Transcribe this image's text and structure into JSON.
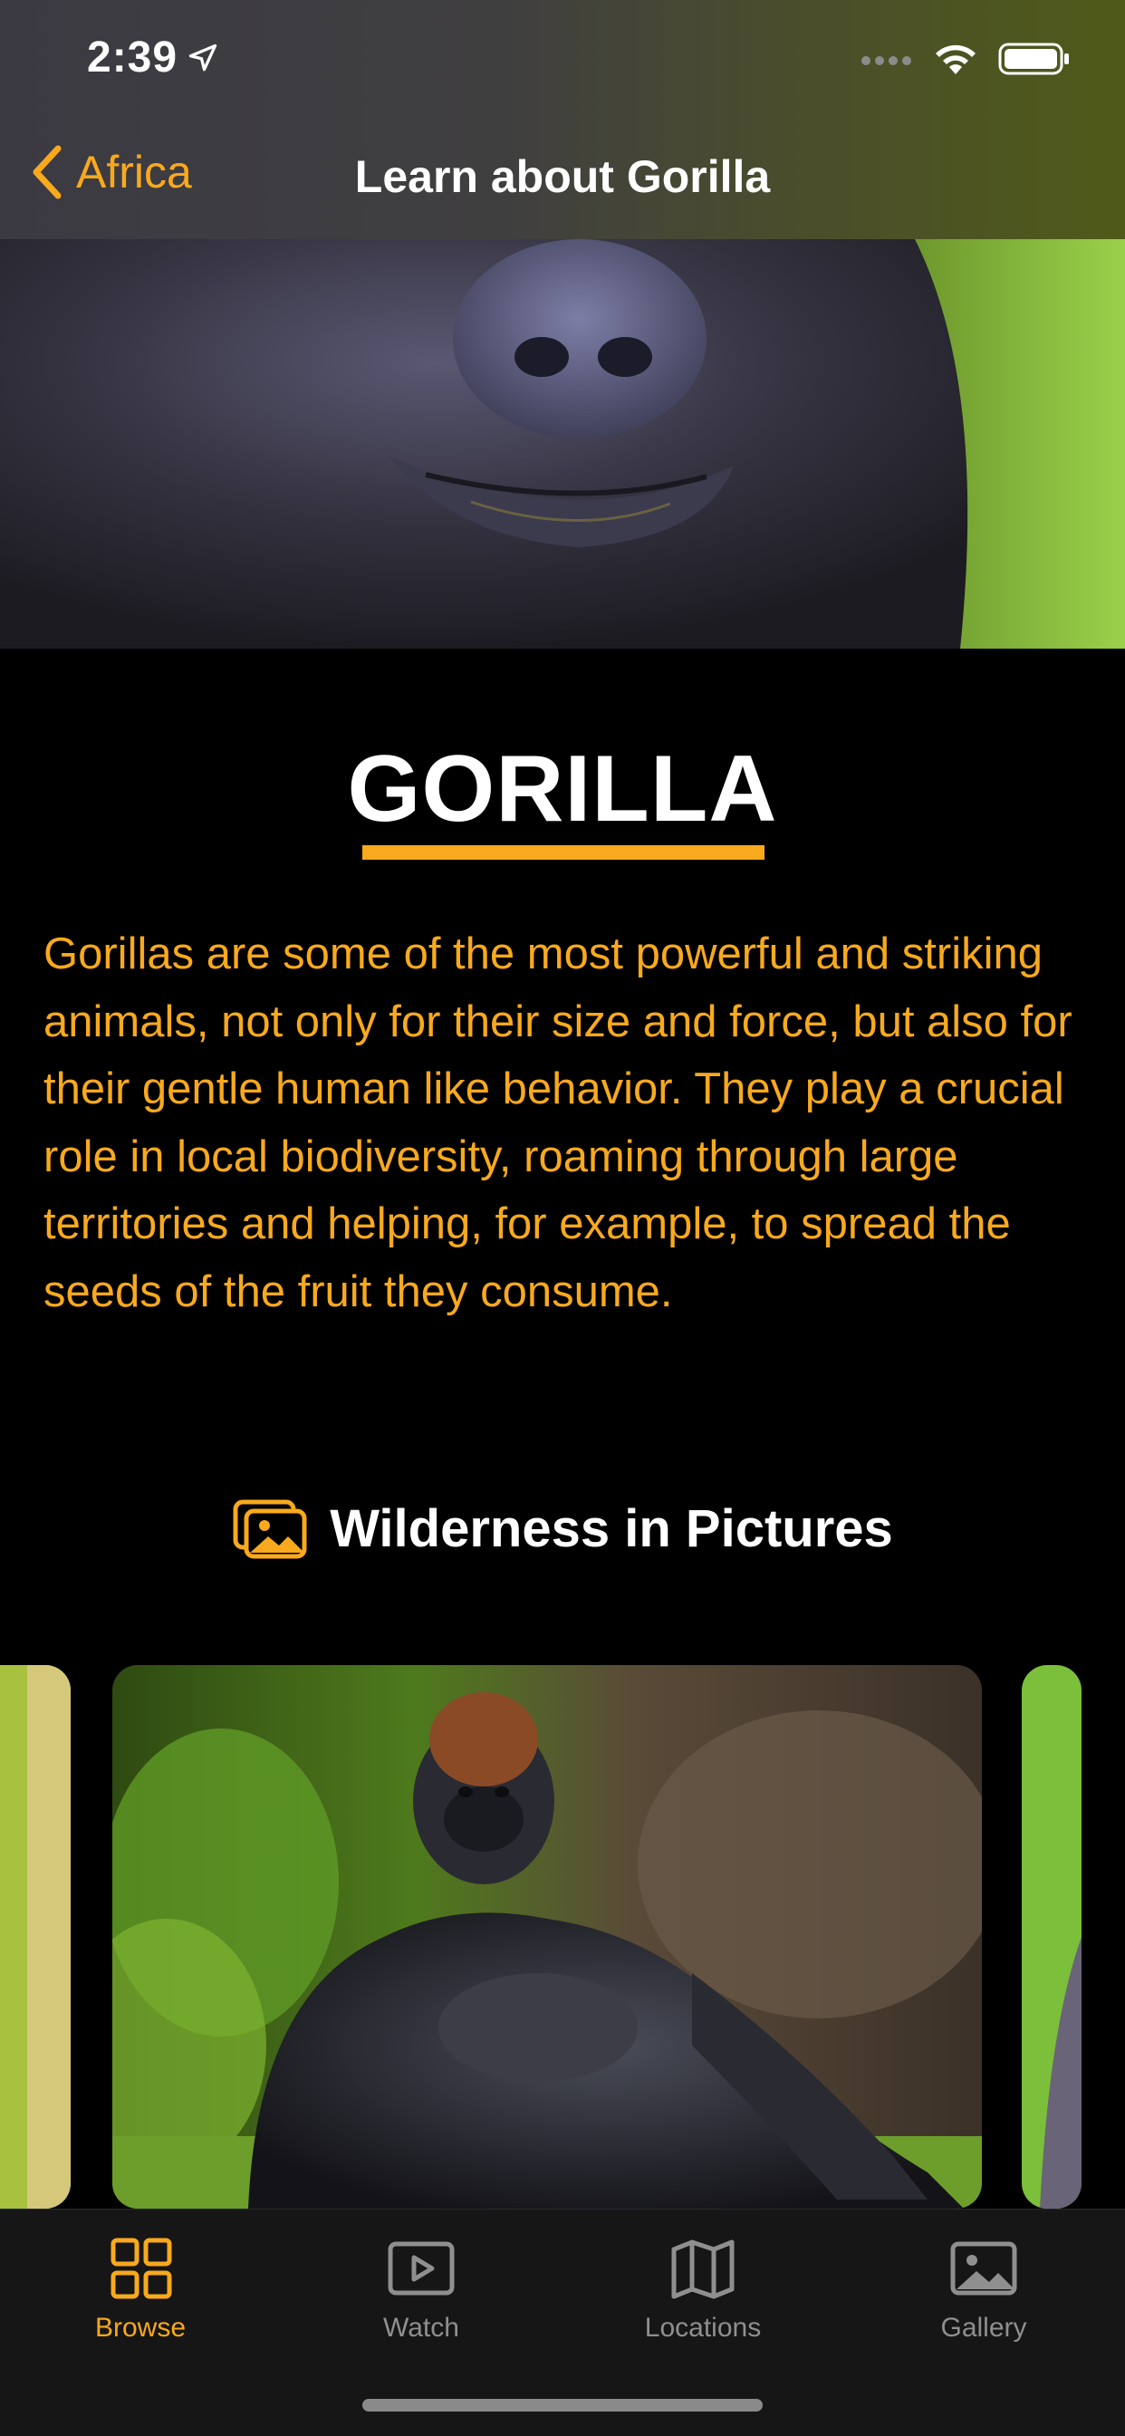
{
  "status_bar": {
    "time": "2:39",
    "icons": [
      "location-arrow-icon",
      "signal-icon",
      "wifi-icon",
      "battery-icon"
    ]
  },
  "nav": {
    "back_label": "Africa",
    "title": "Learn about Gorilla"
  },
  "hero": {
    "image": "gorilla-face-closeup"
  },
  "content": {
    "title": "GORILLA",
    "description": "Gorillas are some of the most powerful and striking animals, not only for their size and force, but also for their gentle human like behavior. They play a crucial role in local biodiversity, roaming through large territories and helping, for example, to spread the seeds of the fruit they consume."
  },
  "gallery_section": {
    "icon": "photos-icon",
    "title": "Wilderness in Pictures",
    "images": [
      "gorilla-partial-left",
      "gorilla-sitting-main",
      "gorilla-partial-right"
    ]
  },
  "tabbar": {
    "tabs": [
      {
        "label": "Browse",
        "icon": "grid-icon",
        "active": true
      },
      {
        "label": "Watch",
        "icon": "play-icon",
        "active": false
      },
      {
        "label": "Locations",
        "icon": "map-icon",
        "active": false
      },
      {
        "label": "Gallery",
        "icon": "photo-icon",
        "active": false
      }
    ]
  },
  "colors": {
    "accent": "#f8a91d",
    "background": "#000000",
    "tabbar": "#161616",
    "inactive": "#8f8f8f"
  }
}
